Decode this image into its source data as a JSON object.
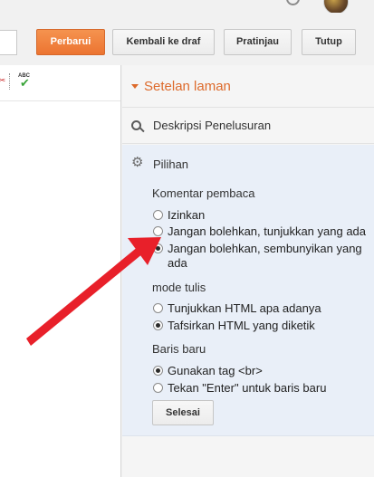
{
  "toolbar": {
    "publish_label": "Perbarui",
    "revert_label": "Kembali ke draf",
    "preview_label": "Pratinjau",
    "close_label": "Tutup"
  },
  "editor_toolbar": {
    "icons": [
      "scissors-icon",
      "spellcheck-icon"
    ],
    "spellcheck_text": "ABC"
  },
  "panel": {
    "title": "Setelan laman",
    "search_description_label": "Deskripsi Penelusuran",
    "options": {
      "title": "Pilihan",
      "reader_comments": {
        "label": "Komentar pembaca",
        "choices": [
          {
            "label": "Izinkan",
            "checked": false
          },
          {
            "label": "Jangan bolehkan, tunjukkan yang ada",
            "checked": false
          },
          {
            "label": "Jangan bolehkan, sembunyikan yang ada",
            "checked": true
          }
        ]
      },
      "compose_mode": {
        "label": "mode tulis",
        "choices": [
          {
            "label": "Tunjukkan HTML apa adanya",
            "checked": false
          },
          {
            "label": "Tafsirkan HTML yang diketik",
            "checked": true
          }
        ]
      },
      "line_breaks": {
        "label": "Baris baru",
        "choices": [
          {
            "label": "Gunakan tag <br>",
            "checked": true
          },
          {
            "label": "Tekan \"Enter\" untuk baris baru",
            "checked": false
          }
        ]
      },
      "done_label": "Selesai"
    }
  },
  "colors": {
    "accent_orange": "#dd6a2b",
    "primary_button": "#ec7431",
    "options_background": "#e9eff8",
    "annotation_arrow": "#e8202a"
  }
}
